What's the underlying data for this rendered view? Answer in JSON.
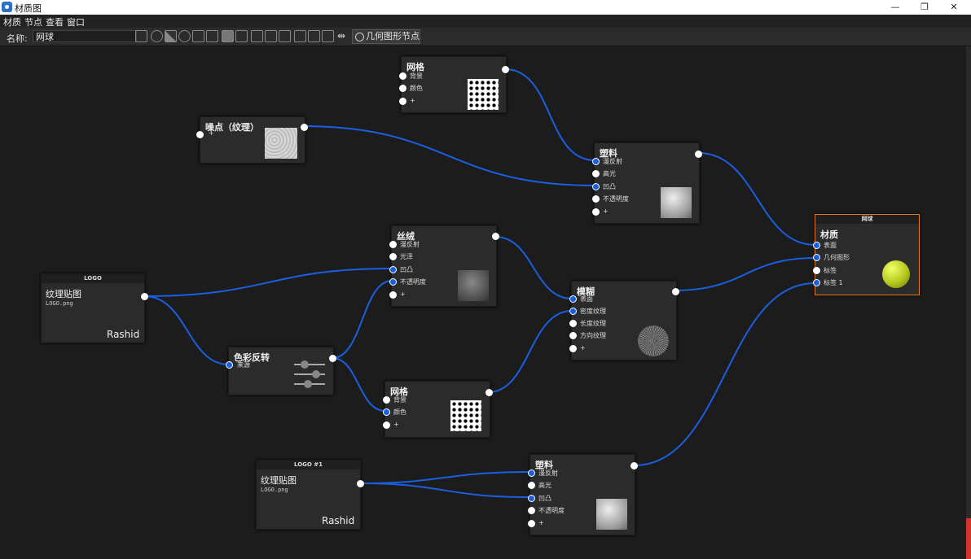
{
  "window": {
    "title": "材质图",
    "minimize": "—",
    "restore": "❐",
    "close": "✕"
  },
  "menu": [
    "材质",
    "节点",
    "查看",
    "窗口"
  ],
  "toolbar": {
    "name_label": "名称:",
    "name_value": "网球",
    "geometry_button": "几何图形节点",
    "icons": [
      "save-icon",
      "sphere-icon",
      "checker-icon",
      "play-icon",
      "sliders-icon",
      "lock-icon",
      "copy-icon",
      "delete-icon",
      "add-node-icon",
      "nodes-icon",
      "link-icon",
      "layout-icon",
      "fit-icon",
      "zoom-icon",
      "arrange-icon"
    ]
  },
  "nodes": {
    "mesh_top": {
      "title": "网格",
      "ports": [
        "背景",
        "颜色",
        "+"
      ]
    },
    "noise": {
      "title": "噪点（纹理）",
      "ports": [
        "+"
      ]
    },
    "plastic_top": {
      "title": "塑料",
      "ports": [
        "漫反射",
        "高光",
        "凹凸",
        "不透明度",
        "+"
      ]
    },
    "velvet": {
      "title": "丝绒",
      "ports": [
        "漫反射",
        "光泽",
        "凹凸",
        "不透明度",
        "+"
      ]
    },
    "texture_logo": {
      "header": "LOGO",
      "title": "纹理贴图",
      "file": "LOGO.png",
      "brand": "Rashid"
    },
    "color_invert": {
      "title": "色彩反转",
      "ports": [
        "来源"
      ]
    },
    "blur": {
      "title": "模糊",
      "ports": [
        "表面",
        "密度纹理",
        "长度纹理",
        "方向纹理",
        "+"
      ]
    },
    "mesh_bottom": {
      "title": "网格",
      "ports": [
        "背景",
        "颜色",
        "+"
      ]
    },
    "material_tennis": {
      "header": "网球",
      "title": "材质",
      "ports": [
        "表面",
        "几何图形",
        "标签",
        "标签 1"
      ]
    },
    "texture_logo1": {
      "header": "LOGO #1",
      "title": "纹理贴图",
      "file": "LOGO.png",
      "brand": "Rashid"
    },
    "plastic_bottom": {
      "title": "塑料",
      "ports": [
        "漫反射",
        "高光",
        "凹凸",
        "不透明度",
        "+"
      ]
    }
  },
  "colors": {
    "wire": "#1a5fe0",
    "selected_border": "#e07a1a",
    "canvas": "#1c1c1c",
    "node": "#2b2b2b"
  }
}
